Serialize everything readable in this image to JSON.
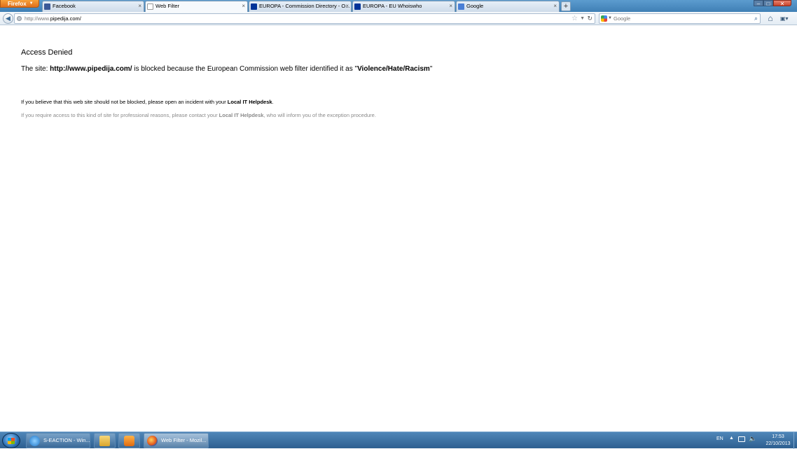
{
  "browser": {
    "menu_button": "Firefox",
    "tabs": [
      {
        "label": "Facebook",
        "icon": "facebook-icon"
      },
      {
        "label": "Web Filter",
        "icon": "blank-page-icon",
        "selected": true
      },
      {
        "label": "EUROPA - Commission Directory - O...",
        "icon": "eu-flag-icon"
      },
      {
        "label": "EUROPA - EU Whoiswho",
        "icon": "eu-flag-icon"
      },
      {
        "label": "Google",
        "icon": "google-icon"
      }
    ],
    "new_tab_label": "+",
    "url_prefix": "http://www.",
    "url_host": "pipedija.com/",
    "search_placeholder": "Google"
  },
  "page": {
    "heading": "Access Denied",
    "message_prefix": "The site: ",
    "blocked_url": "http://www.pipedija.com/",
    "message_middle": " is blocked because the European Commission web filter identified it as \"",
    "category": "Violence/Hate/Racism",
    "message_suffix": "\"",
    "helpdesk_prefix": "If you believe that this web site should not be blocked, please open an incident with your ",
    "helpdesk_name": "Local IT Helpdesk",
    "helpdesk_suffix": ".",
    "exception_prefix": "If you require access to this kind of site for professional reasons, please contact your ",
    "exception_helpdesk": "Local IT Helpdesk",
    "exception_suffix": ", who will inform you of the exception procedure."
  },
  "taskbar": {
    "tasks": [
      {
        "label": "S-EACTION - Win...",
        "icon": "internet-explorer-icon"
      },
      {
        "label": "",
        "icon": "folder-icon"
      },
      {
        "label": "",
        "icon": "media-player-icon"
      },
      {
        "label": "Web Filter - Mozil...",
        "icon": "firefox-icon",
        "active": true
      }
    ],
    "language": "EN",
    "time": "17:53",
    "date": "22/10/2013"
  }
}
